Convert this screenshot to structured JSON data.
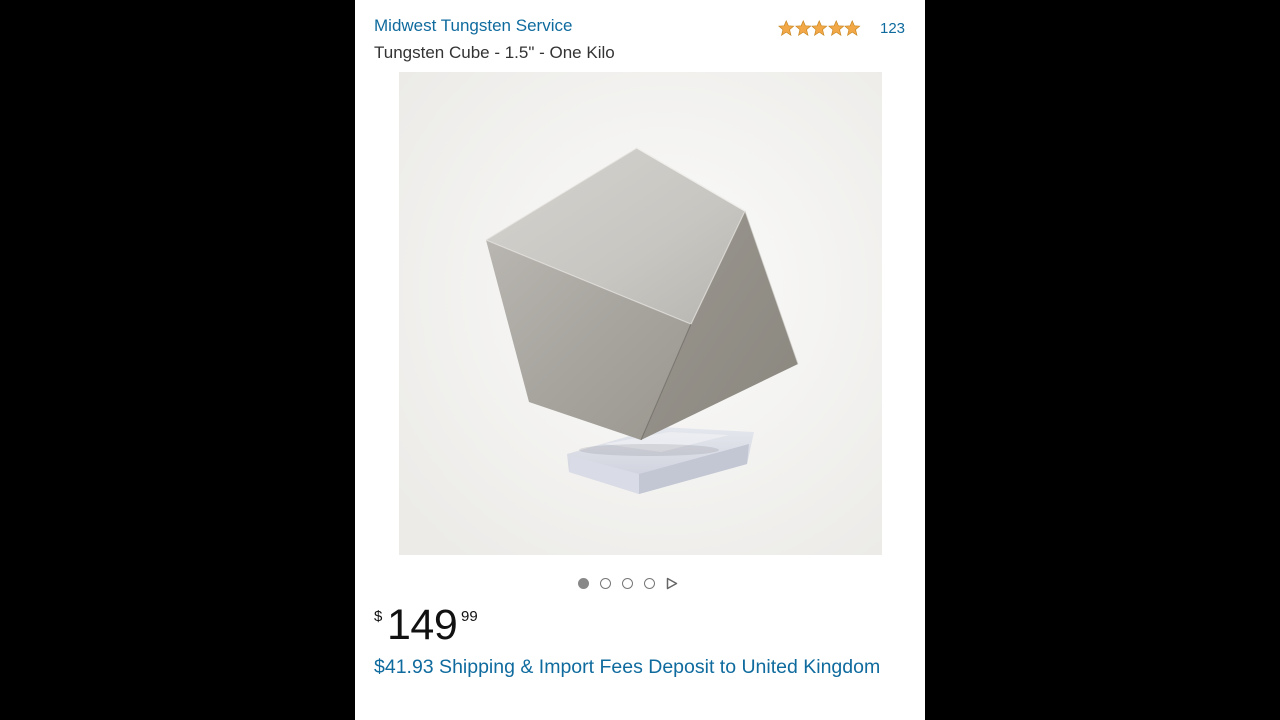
{
  "listing": {
    "seller": "Midwest Tungsten Service",
    "rating": {
      "stars": 5,
      "review_count": "123"
    },
    "title": "Tungsten Cube - 1.5\" - One Kilo",
    "image": {
      "subject": "tungsten-cube-on-acrylic-stand"
    },
    "carousel": {
      "total_dots": 4,
      "active_index": 0,
      "next_icon": "play-triangle-icon"
    },
    "price": {
      "currency_symbol": "$",
      "whole": "149",
      "fraction": "99"
    },
    "shipping": "$41.93 Shipping & Import Fees Deposit to United Kingdom"
  },
  "colors": {
    "link_blue": "#0f6b9e",
    "star_orange": "#f3a847",
    "background_black": "#000000",
    "card_white": "#ffffff"
  }
}
